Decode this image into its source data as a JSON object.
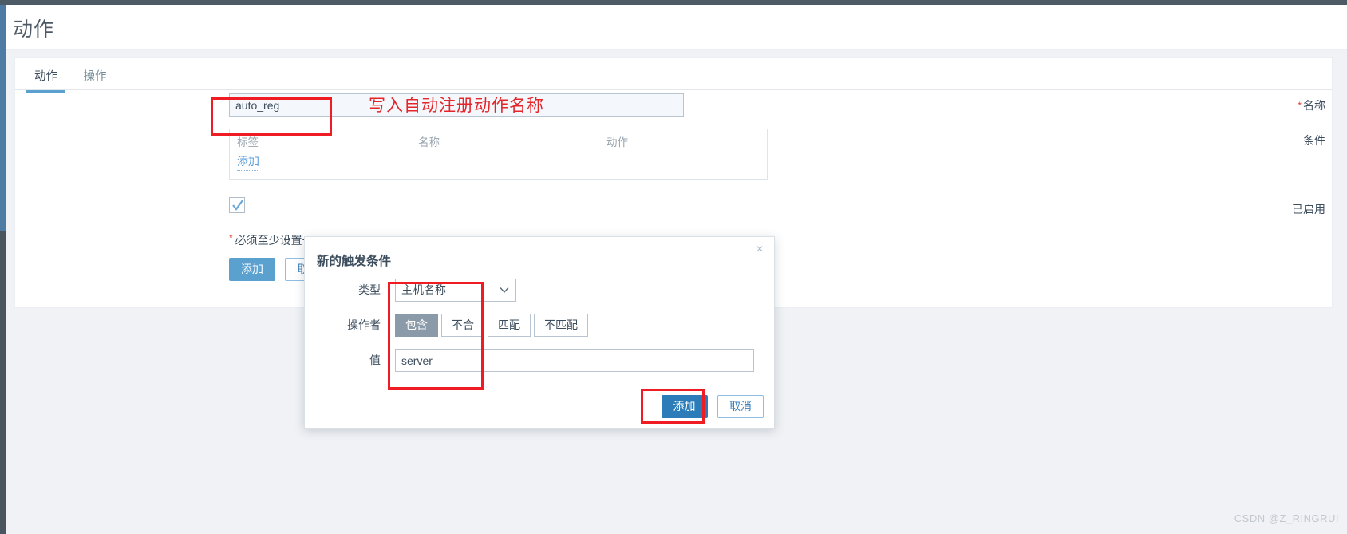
{
  "page": {
    "title": "动作",
    "watermark": "CSDN @Z_RINGRUI"
  },
  "tabs": [
    {
      "label": "动作",
      "active": true
    },
    {
      "label": "操作",
      "active": false
    }
  ],
  "form": {
    "name_row": {
      "label": "名称",
      "required_mark": "*",
      "value": "auto_reg",
      "annotation": "写入自动注册动作名称"
    },
    "conditions_row": {
      "label": "条件",
      "columns": [
        "标签",
        "名称",
        "动作"
      ],
      "rows": [],
      "add_link": "添加"
    },
    "enabled_row": {
      "label": "已启用",
      "checked": true
    },
    "hint": {
      "required_mark": "*",
      "text": "必须至少设置一"
    },
    "buttons": {
      "submit": "添加",
      "cancel": "取消"
    }
  },
  "modal": {
    "title": "新的触发条件",
    "close_label": "×",
    "type_row": {
      "label": "类型",
      "selected": "主机名称"
    },
    "operator_row": {
      "label": "操作者",
      "options": [
        "包含",
        "不合",
        "匹配",
        "不匹配"
      ],
      "selected_index": 0
    },
    "value_row": {
      "label": "值",
      "value": "server"
    },
    "buttons": {
      "submit": "添加",
      "cancel": "取消"
    }
  },
  "colors": {
    "accent": "#2b7cb8",
    "tab_underline": "#5ba1d0",
    "annotation_red": "#ef1c24",
    "required_red": "#e33734",
    "segment_on": "#8b9aa8"
  }
}
